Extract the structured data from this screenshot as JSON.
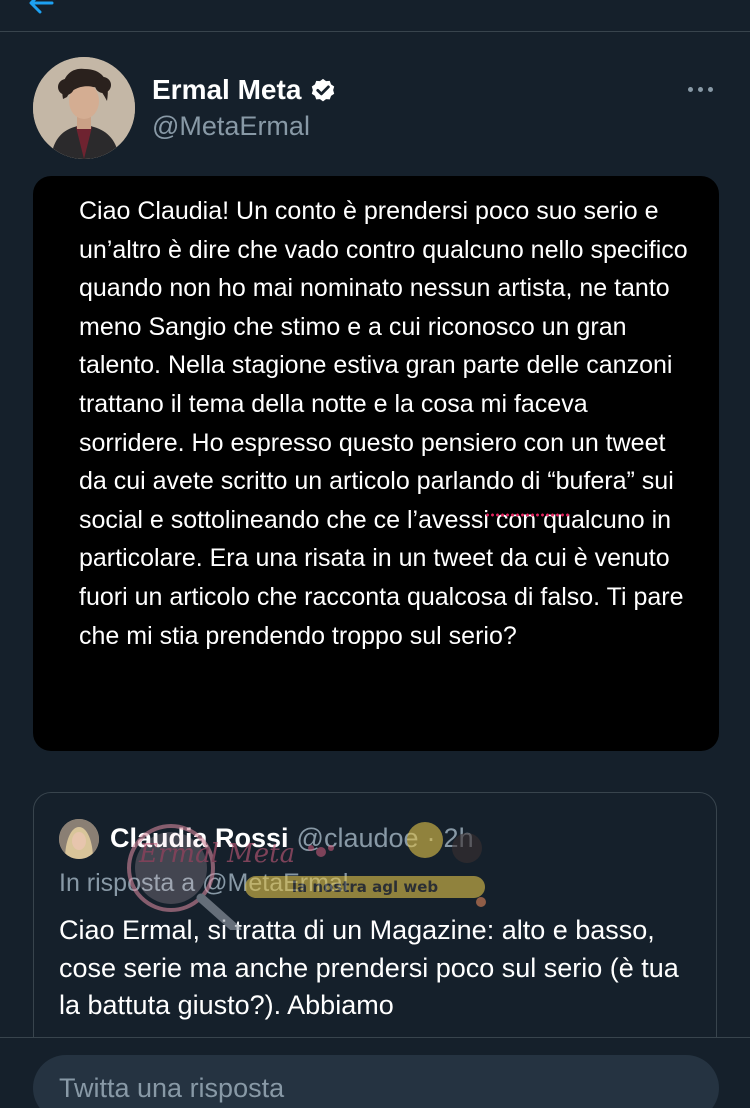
{
  "author": {
    "name": "Ermal Meta",
    "handle": "@MetaErmal",
    "verified": true
  },
  "tweet_image_text": "Ciao Claudia! Un conto è prendersi poco suo serio e un’altro è dire che vado contro qualcuno nello specifico quando non ho mai nominato nessun artista, ne tanto meno Sangio che stimo e a cui riconosco un gran talento. Nella stagione estiva gran parte delle canzoni trattano il tema della notte e la cosa mi faceva sorridere. Ho espresso questo pensiero con un tweet da cui avete scritto un articolo parlando di “bufera” sui social e sottolineando che ce l’avessi con qualcuno in particolare. Era una risata in un tweet da cui è venuto fuori un articolo che racconta qualcosa di falso. Ti pare che mi stia prendendo troppo sul serio?",
  "quoted_tweet": {
    "name": "Claudia Rossi",
    "handle": "@claudoe",
    "separator": "·",
    "time": "2h",
    "reply_prefix": "In risposta a",
    "reply_to": "@MetaErmal",
    "text": "Ciao Ermal, si tratta di un Magazine: alto e basso, cose serie ma anche prendersi poco sul serio (è tua la battuta giusto?). Abbiamo"
  },
  "watermark": {
    "script_text": "Ermal Meta",
    "banner_text": "la nostra agl web"
  },
  "composer": {
    "placeholder": "Twitta una risposta"
  },
  "colors": {
    "background": "#15202b",
    "card": "#000000",
    "accent": "#1da1f2",
    "secondary_text": "#8899a6",
    "divider": "#38444d"
  },
  "icons": {
    "back": "arrow-left-icon",
    "verified": "verified-badge-icon",
    "more": "more-horizontal-icon"
  }
}
